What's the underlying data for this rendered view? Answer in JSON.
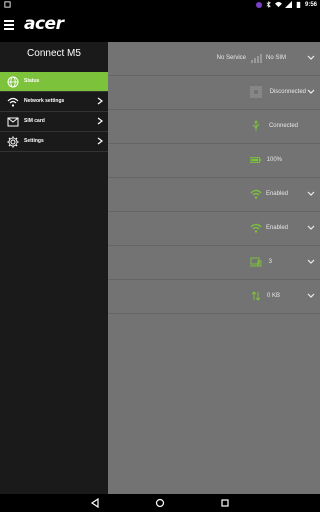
{
  "status_bar": {
    "time": "9:56"
  },
  "app": {
    "logo_text": "acer"
  },
  "drawer": {
    "title": "Connect M5",
    "items": [
      {
        "label": "Status",
        "icon": "globe-icon",
        "active": true
      },
      {
        "label": "Network settings",
        "icon": "wifi-icon",
        "active": false
      },
      {
        "label": "SIM card",
        "icon": "sim-card-icon",
        "active": false
      },
      {
        "label": "Settings",
        "icon": "gear-icon",
        "active": false
      }
    ]
  },
  "status_rows": [
    {
      "prefix": "No Service",
      "value": "No SIM",
      "icon": "signal-bars-icon",
      "dropdown": true
    },
    {
      "value": "Disconnected",
      "icon": "network-box-icon",
      "dropdown": true
    },
    {
      "value": "Connected",
      "icon": "usb-icon",
      "dropdown": false
    },
    {
      "value": "100%",
      "icon": "battery-icon",
      "dropdown": false
    },
    {
      "value": "Enabled",
      "icon": "wifi-icon",
      "dropdown": true
    },
    {
      "value": "Enabled",
      "icon": "wifi-icon",
      "dropdown": true
    },
    {
      "value": "3",
      "icon": "devices-icon",
      "dropdown": true
    },
    {
      "value": "0 KB",
      "icon": "data-transfer-icon",
      "dropdown": true
    }
  ],
  "colors": {
    "accent": "#7cc23b",
    "drawer_bg": "#1a1a1a",
    "content_bg": "#737373"
  }
}
